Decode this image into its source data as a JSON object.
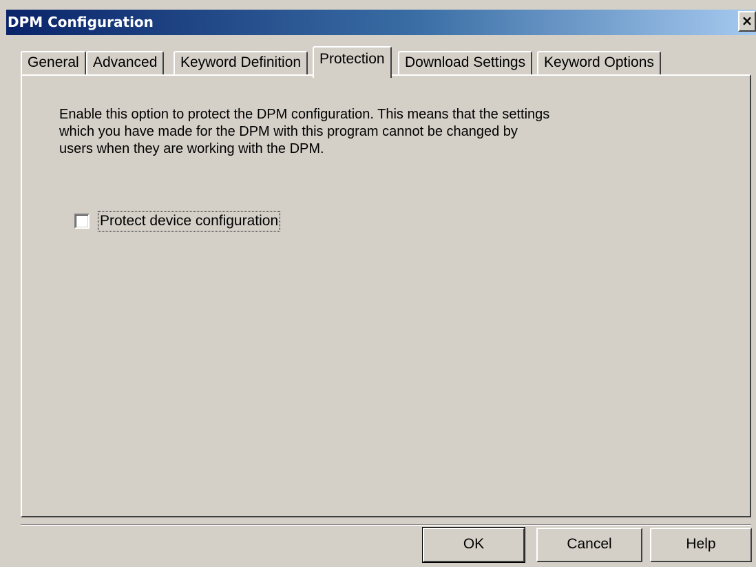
{
  "window": {
    "title": "DPM Configuration",
    "close_label": "×"
  },
  "tabs": [
    {
      "label": "General",
      "active": false
    },
    {
      "label": "Advanced",
      "active": false
    },
    {
      "label": "Keyword Definition",
      "active": false
    },
    {
      "label": "Protection",
      "active": true
    },
    {
      "label": "Download Settings",
      "active": false
    },
    {
      "label": "Keyword Options",
      "active": false
    }
  ],
  "protection": {
    "description": "Enable this option to protect the DPM configuration. This means that the settings which you have made for the DPM with this program cannot be changed by users when they are working with the DPM.",
    "checkbox_label": "Protect device configuration",
    "checkbox_checked": false
  },
  "buttons": {
    "ok": "OK",
    "cancel": "Cancel",
    "help": "Help"
  },
  "colors": {
    "titlebar_start": "#0a246a",
    "titlebar_end": "#a6caf0",
    "face": "#d4d0c8"
  }
}
